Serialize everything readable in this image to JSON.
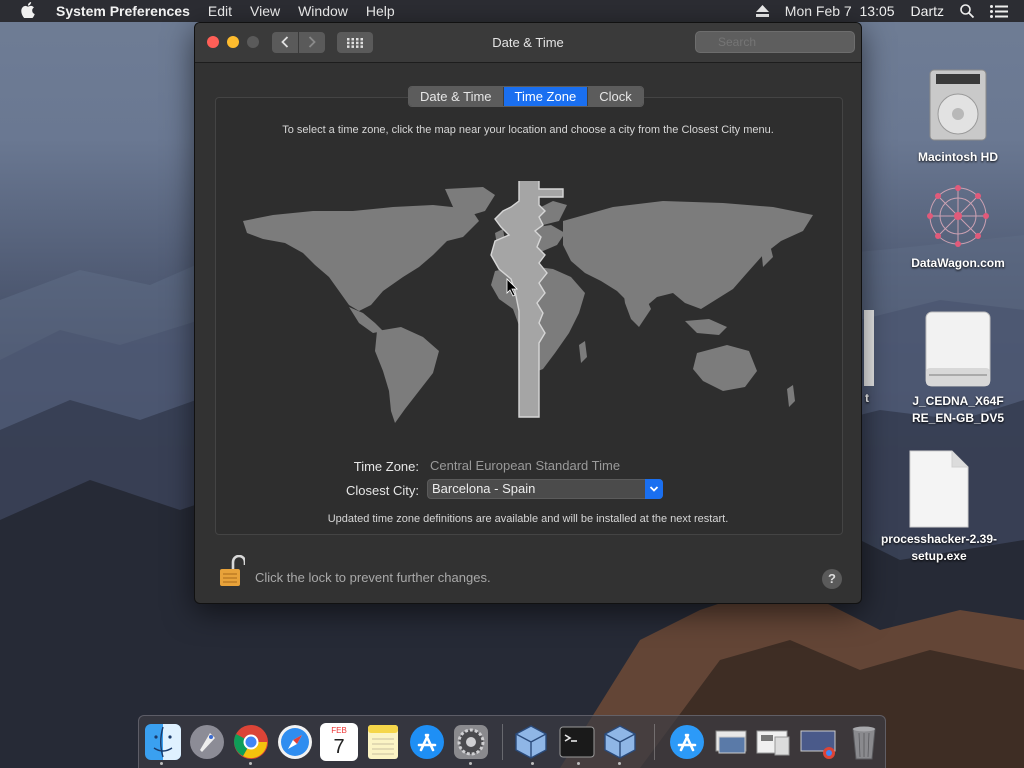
{
  "menubar": {
    "app_name": "System Preferences",
    "menus": [
      "Edit",
      "View",
      "Window",
      "Help"
    ],
    "datetime": "Mon Feb 7  13:05",
    "user": "Dartz"
  },
  "window": {
    "title": "Date & Time",
    "search_placeholder": "Search",
    "tabs": [
      {
        "label": "Date & Time",
        "active": false
      },
      {
        "label": "Time Zone",
        "active": true
      },
      {
        "label": "Clock",
        "active": false
      }
    ],
    "instructions": "To select a time zone, click the map near your location and choose a city from the Closest City menu.",
    "time_zone_label": "Time Zone:",
    "time_zone_value": "Central European Standard Time",
    "closest_city_label": "Closest City:",
    "closest_city_value": "Barcelona - Spain",
    "notice": "Updated time zone definitions are available and will be installed at the next restart.",
    "lock_text": "Click the lock to prevent further changes.",
    "help_label": "?"
  },
  "desktop": {
    "icons": [
      {
        "label": "Macintosh HD"
      },
      {
        "label": "DataWagon.com"
      },
      {
        "label": "t"
      },
      {
        "label": "J_CEDNA_X64FRE_EN-GB_DV5"
      },
      {
        "label": "processhacker-2.39-setup.exe"
      }
    ]
  },
  "dock": {
    "calendar_month": "FEB",
    "calendar_day": "7"
  },
  "colors": {
    "accent": "#1a6ff0",
    "close": "#ff5f57",
    "minimize": "#febc2e"
  }
}
